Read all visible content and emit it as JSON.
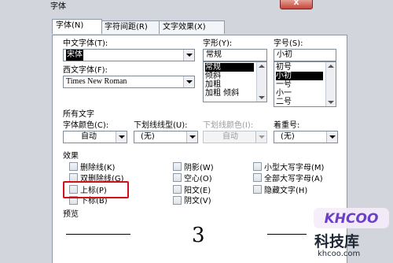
{
  "window": {
    "title": "字体",
    "close_label": "X"
  },
  "tabs": [
    {
      "label": "字体(N)"
    },
    {
      "label": "字符间距(R)"
    },
    {
      "label": "文字效果(X)"
    }
  ],
  "font_section": {
    "chinese_font_label": "中文字体(T):",
    "chinese_font_value": "宋体",
    "western_font_label": "西文字体(F):",
    "western_font_value": "Times New Roman",
    "style_label": "字形(Y):",
    "style_value": "常规",
    "style_options": [
      "常规",
      "倾斜",
      "加粗",
      "加粗 倾斜"
    ],
    "size_label": "字号(S):",
    "size_value": "小初",
    "size_options": [
      "初号",
      "小初",
      "一号",
      "小一",
      "二号"
    ]
  },
  "all_text": {
    "heading": "所有文字",
    "font_color_label": "字体颜色(C):",
    "font_color_value": "自动",
    "underline_label": "下划线线型(U):",
    "underline_value": "(无)",
    "underline_color_label": "下划线颜色(I):",
    "underline_color_value": "自动",
    "emphasis_label": "着重号:",
    "emphasis_value": "(无)"
  },
  "effects": {
    "heading": "效果",
    "items": [
      {
        "label": "删除线(K)"
      },
      {
        "label": "双删除线(G)"
      },
      {
        "label": "上标(P)"
      },
      {
        "label": "下标(B)"
      },
      {
        "label": "阴影(W)"
      },
      {
        "label": "空心(O)"
      },
      {
        "label": "阳文(E)"
      },
      {
        "label": "阴文(V)"
      },
      {
        "label": "小型大写字母(M)"
      },
      {
        "label": "全部大写字母(A)"
      },
      {
        "label": "隐藏文字(H)"
      }
    ]
  },
  "preview": {
    "heading": "预览",
    "sample_text": "3"
  },
  "watermark": {
    "logo_text": "KHCOO",
    "site_name": "科技库",
    "url": "khcoo.com"
  },
  "colors": {
    "highlight": "#d0101a",
    "dialog_bg": "#d2d6dc"
  }
}
